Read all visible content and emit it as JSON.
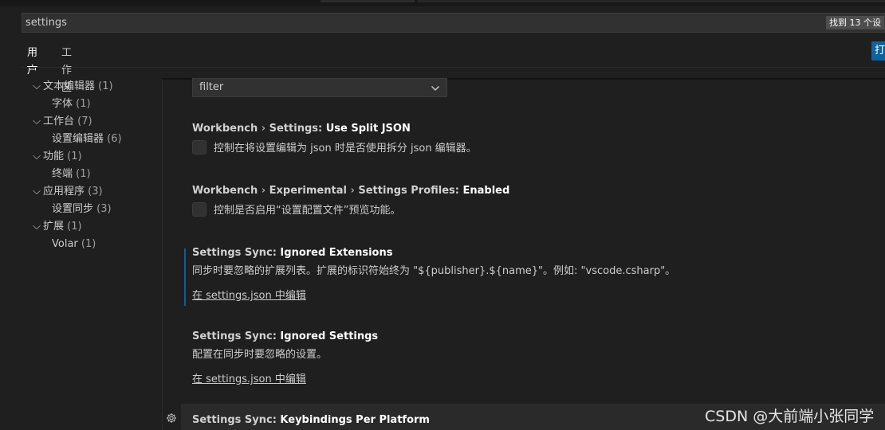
{
  "search": {
    "value": "settings",
    "result_count": "找到 13 个设"
  },
  "tabs": [
    {
      "label": "用户"
    },
    {
      "label": "工作区"
    }
  ],
  "open_button_label": "打",
  "toc": [
    {
      "label": "文本编辑器",
      "count": "(1)",
      "expanded": true
    },
    {
      "label": "字体",
      "count": "(1)"
    },
    {
      "label": "工作台",
      "count": "(7)",
      "expanded": true
    },
    {
      "label": "设置编辑器",
      "count": "(6)"
    },
    {
      "label": "功能",
      "count": "(1)",
      "expanded": true
    },
    {
      "label": "终端",
      "count": "(1)"
    },
    {
      "label": "应用程序",
      "count": "(3)",
      "expanded": true
    },
    {
      "label": "设置同步",
      "count": "(3)"
    },
    {
      "label": "扩展",
      "count": "(1)",
      "expanded": true
    },
    {
      "label": "Volar",
      "count": "(1)"
    }
  ],
  "dropdown_value": "filter",
  "settings": [
    {
      "category_parts": [
        "Workbench",
        "Settings"
      ],
      "key": "Use Split JSON",
      "description": "控制在将设置编辑为 json 时是否使用拆分 json 编辑器。",
      "checked": false
    },
    {
      "category_parts": [
        "Workbench",
        "Experimental",
        "Settings Profiles"
      ],
      "key": "Enabled",
      "description": "控制是否启用“设置配置文件”预览功能。",
      "checked": false
    },
    {
      "category": "Settings Sync",
      "key": "Ignored Extensions",
      "description": "同步时要忽略的扩展列表。扩展的标识符始终为 \"${publisher}.${name}\"。例如: \"vscode.csharp\"。",
      "link": "在 settings.json 中编辑"
    },
    {
      "category": "Settings Sync",
      "key": "Ignored Settings",
      "description": "配置在同步时要忽略的设置。",
      "link": "在 settings.json 中编辑"
    },
    {
      "category": "Settings Sync",
      "key": "Keybindings Per Platform"
    }
  ],
  "watermark": "CSDN @大前端小张同学",
  "colors": {
    "background": "#1f1f1f",
    "accent": "#007acc",
    "button": "#0e639c"
  }
}
